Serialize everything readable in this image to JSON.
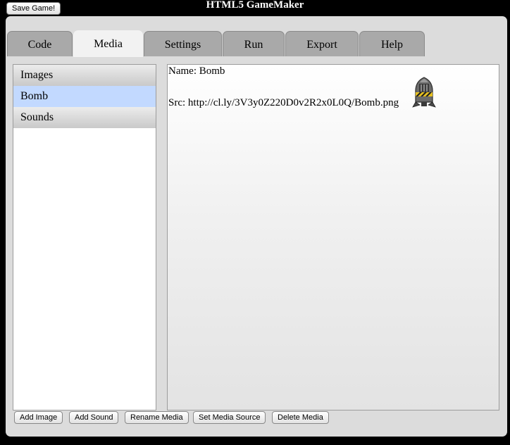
{
  "app": {
    "title": "HTML5 GameMaker",
    "save_label": "Save Game!"
  },
  "tabs": [
    {
      "label": "Code"
    },
    {
      "label": "Media",
      "active": true
    },
    {
      "label": "Settings"
    },
    {
      "label": "Run"
    },
    {
      "label": "Export"
    },
    {
      "label": "Help"
    }
  ],
  "sidebar": {
    "items": [
      {
        "label": "Images"
      },
      {
        "label": "Bomb",
        "selected": true
      },
      {
        "label": "Sounds"
      }
    ]
  },
  "details": {
    "name_line": "Name: Bomb",
    "src_line": "Src: http://cl.ly/3V3y0Z220D0v2R2x0L0Q/Bomb.png",
    "preview_icon": "bomb-sprite-icon"
  },
  "actions": {
    "add_image": "Add Image",
    "add_sound": "Add Sound",
    "rename_media": "Rename Media",
    "set_media_source": "Set Media Source",
    "delete_media": "Delete Media"
  },
  "colors": {
    "selected_item": "#c2d9ff",
    "tab_inactive": "#a9a9a9",
    "tab_active": "#f2f2f2",
    "panel": "#dcdcdc"
  }
}
